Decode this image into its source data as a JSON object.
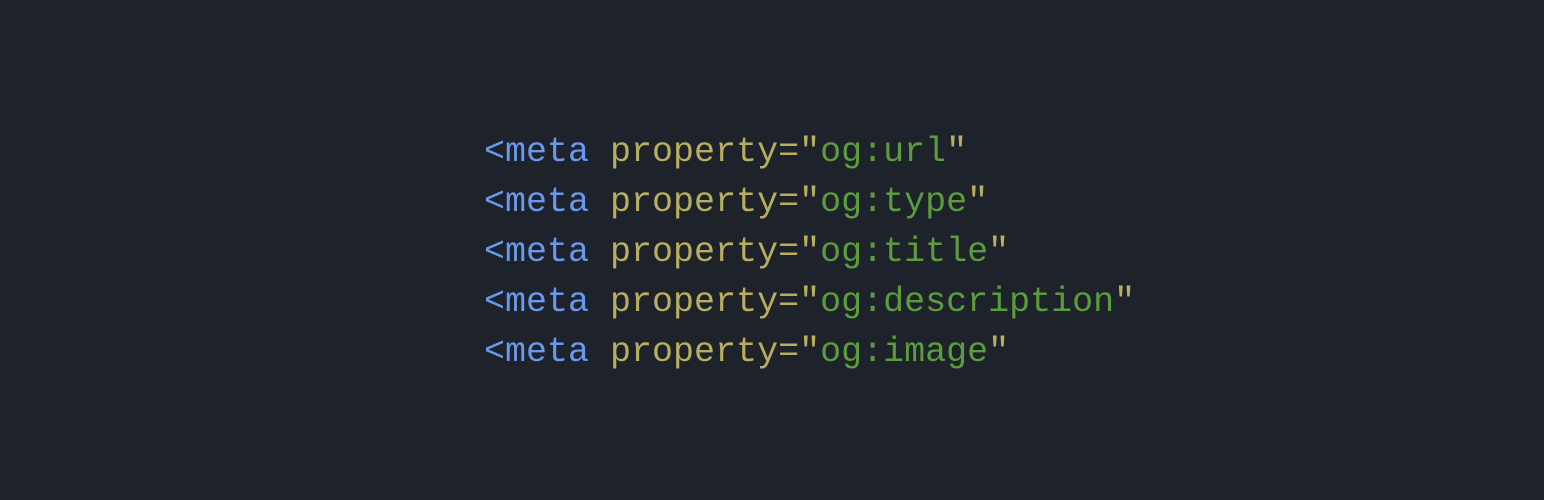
{
  "colors": {
    "background": "#1e222b",
    "tag": "#6a98ec",
    "attribute": "#b9ae5e",
    "string": "#5b9d3c"
  },
  "code": {
    "lines": [
      {
        "tag": "<meta",
        "attr": "property",
        "eq": "=",
        "quote_open": "\"",
        "value": "og:url",
        "quote_close": "\""
      },
      {
        "tag": "<meta",
        "attr": "property",
        "eq": "=",
        "quote_open": "\"",
        "value": "og:type",
        "quote_close": "\""
      },
      {
        "tag": "<meta",
        "attr": "property",
        "eq": "=",
        "quote_open": "\"",
        "value": "og:title",
        "quote_close": "\""
      },
      {
        "tag": "<meta",
        "attr": "property",
        "eq": "=",
        "quote_open": "\"",
        "value": "og:description",
        "quote_close": "\""
      },
      {
        "tag": "<meta",
        "attr": "property",
        "eq": "=",
        "quote_open": "\"",
        "value": "og:image",
        "quote_close": "\""
      }
    ]
  }
}
